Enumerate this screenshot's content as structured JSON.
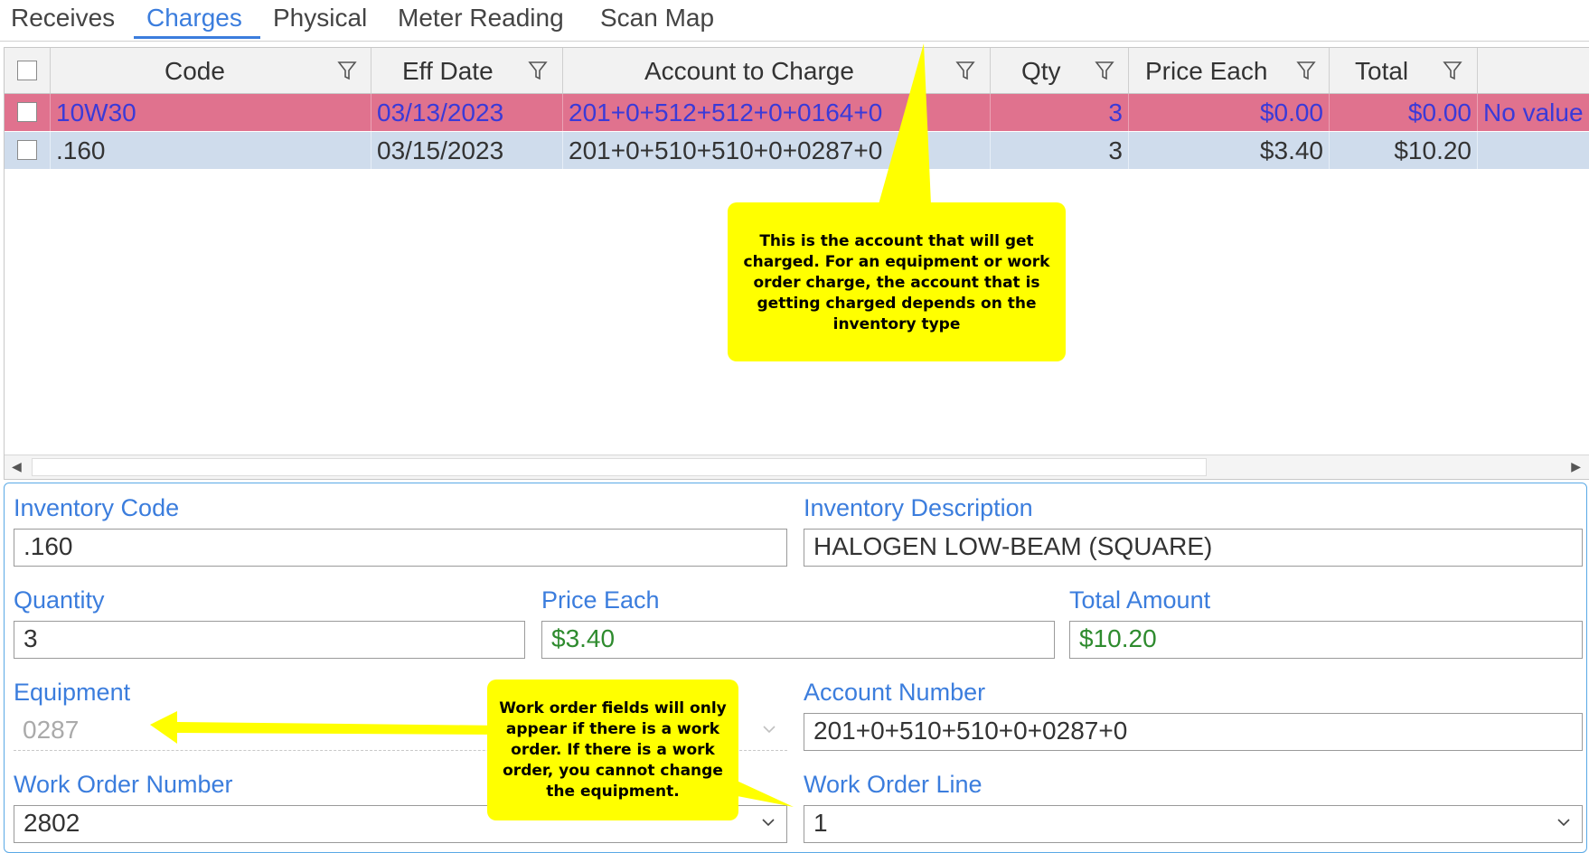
{
  "tabs": [
    {
      "label": "Receives"
    },
    {
      "label": "Charges"
    },
    {
      "label": "Physical"
    },
    {
      "label": "Meter Reading"
    },
    {
      "label": "Scan Map"
    }
  ],
  "grid": {
    "columns": [
      "Code",
      "Eff Date",
      "Account to Charge",
      "Qty",
      "Price Each",
      "Total"
    ],
    "rows": [
      {
        "code": "10W30",
        "eff_date": "03/13/2023",
        "account": "201+0+512+512+0+0164+0",
        "qty": "3",
        "price_each": "$0.00",
        "total": "$0.00",
        "note": "No value"
      },
      {
        "code": ".160",
        "eff_date": "03/15/2023",
        "account": "201+0+510+510+0+0287+0",
        "qty": "3",
        "price_each": "$3.40",
        "total": "$10.20",
        "note": ""
      }
    ]
  },
  "form": {
    "inventory_code": {
      "label": "Inventory Code",
      "value": ".160"
    },
    "inventory_description": {
      "label": "Inventory Description",
      "value": "HALOGEN LOW-BEAM (SQUARE)"
    },
    "quantity": {
      "label": "Quantity",
      "value": "3"
    },
    "price_each": {
      "label": "Price Each",
      "value": "$3.40"
    },
    "total_amount": {
      "label": "Total Amount",
      "value": "$10.20"
    },
    "equipment": {
      "label": "Equipment",
      "value": "0287"
    },
    "account_number": {
      "label": "Account Number",
      "value": "201+0+510+510+0+0287+0"
    },
    "work_order_number": {
      "label": "Work Order Number",
      "value": "2802"
    },
    "work_order_line": {
      "label": "Work Order Line",
      "value": "1"
    }
  },
  "callouts": {
    "account": "This is the account that will get charged. For an equipment or work order charge, the account that is getting charged depends on the inventory type",
    "work_order": "Work order fields will only appear if there is a work order. If there is a work order, you cannot change the equipment."
  },
  "colors": {
    "accent": "#3b7ddd",
    "error_row": "#e0728e",
    "selected_row": "#cfdcec",
    "money": "#2e8b2e",
    "callout": "#ffff00"
  },
  "icons": [
    "filter-icon",
    "checkbox-icon",
    "chevron-down-icon",
    "scroll-left-icon",
    "scroll-right-icon"
  ]
}
